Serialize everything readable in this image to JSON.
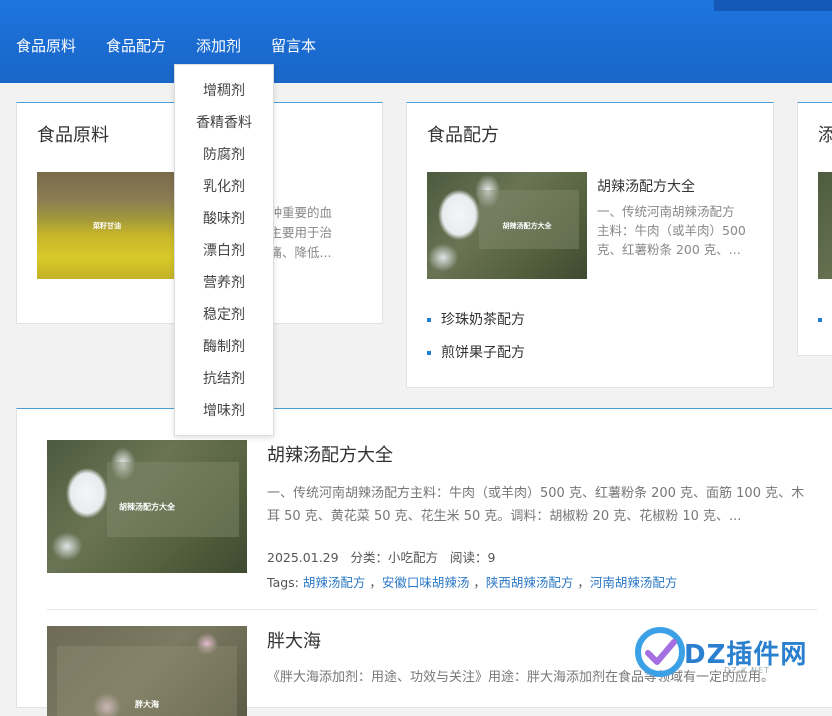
{
  "nav": {
    "items": [
      "食品原料",
      "食品配方",
      "添加剂",
      "留言本"
    ]
  },
  "dropdown": {
    "items": [
      "增稠剂",
      "香精香料",
      "防腐剂",
      "乳化剂",
      "酸味剂",
      "漂白剂",
      "营养剂",
      "稳定剂",
      "酶制剂",
      "抗结剂",
      "增味剂"
    ]
  },
  "card1": {
    "title": "食品原料",
    "thumb_caption": "菜籽甘油",
    "snippet_line1": "一种重要的血",
    "snippet_line2": "，主要用于治",
    "snippet_line3": "绞痛、降低..."
  },
  "card2": {
    "title": "食品配方",
    "thumb_caption": "胡辣汤配方大全",
    "snippet_title": "胡辣汤配方大全",
    "snippet_line1": "一、传统河南胡辣汤配方",
    "snippet_line2": "主料：牛肉（或羊肉）500",
    "snippet_line3": "克、红薯粉条 200 克、...",
    "links": [
      "珍珠奶茶配方",
      "煎饼果子配方"
    ]
  },
  "card3": {
    "title": "添"
  },
  "articles": [
    {
      "thumb_caption": "胡辣汤配方大全",
      "title": "胡辣汤配方大全",
      "excerpt": "一、传统河南胡辣汤配方主料：牛肉（或羊肉）500 克、红薯粉条 200 克、面筋 100 克、木耳 50 克、黄花菜 50 克、花生米 50 克。调料：胡椒粉 20 克、花椒粉 10 克、...",
      "date": "2025.01.29",
      "category_label": "分类：",
      "category": "小吃配方",
      "reads_label": "阅读：",
      "reads": "9",
      "tags_label": "Tags:",
      "tags": [
        "胡辣汤配方",
        "安徽口味胡辣汤",
        "陕西胡辣汤配方",
        "河南胡辣汤配方"
      ]
    },
    {
      "thumb_caption": "胖大海",
      "title": "胖大海",
      "excerpt": "《胖大海添加剂：用途、功效与关注》用途：胖大海添加剂在食品等领域有一定的应用。"
    }
  ],
  "watermark": {
    "text": "DZ插件网",
    "sub": "DZ-X.NET"
  },
  "colors": {
    "header_blue": "#1d75dd",
    "accent_line": "#4a9fd8",
    "link_blue": "#2b78c6"
  }
}
